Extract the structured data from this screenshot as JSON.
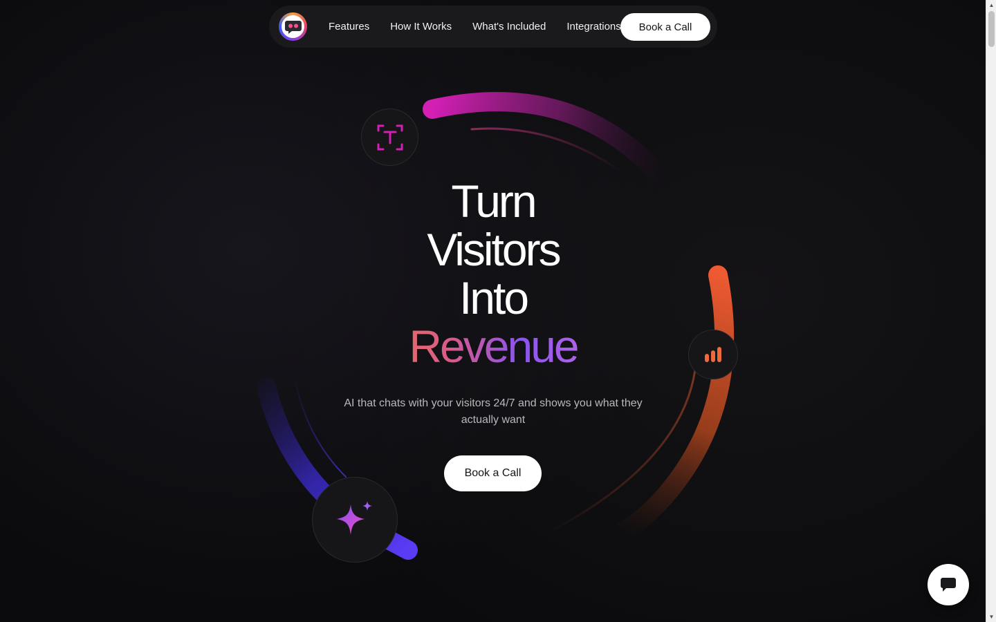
{
  "nav": {
    "items": [
      {
        "label": "Features"
      },
      {
        "label": "How It Works"
      },
      {
        "label": "What's Included"
      },
      {
        "label": "Integrations"
      }
    ],
    "cta_label": "Book a Call"
  },
  "hero": {
    "title_lines": [
      "Turn",
      "Visitors",
      "Into"
    ],
    "title_highlight": "Revenue",
    "subtitle": "AI that chats with your visitors 24/7 and shows you what they actually want",
    "cta_label": "Book a Call"
  },
  "badges": {
    "text": {
      "icon": "text-scan-icon",
      "color": "#d41fb5"
    },
    "chart": {
      "icon": "bar-chart-icon",
      "color": "#ee6a3c"
    },
    "sparkle": {
      "icon": "sparkle-icon",
      "color": "#8a4cf0"
    }
  },
  "colors": {
    "magenta": "#d41fb5",
    "orange": "#ee5a32",
    "indigo": "#4b34f0",
    "background": "#0b0b0d"
  }
}
